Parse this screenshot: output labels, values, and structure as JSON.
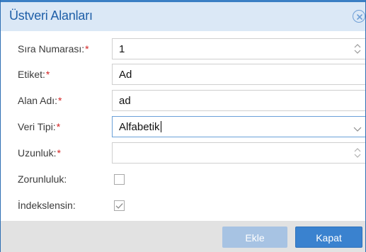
{
  "dialog": {
    "title": "Üstveri Alanları",
    "close_icon": "close-circle-icon"
  },
  "form": {
    "sira_numarasi": {
      "label": "Sıra Numarası:",
      "required_mark": "*",
      "value": "1"
    },
    "etiket": {
      "label": "Etiket:",
      "required_mark": "*",
      "value": "Ad"
    },
    "alan_adi": {
      "label": "Alan Adı:",
      "required_mark": "*",
      "value": "ad"
    },
    "veri_tipi": {
      "label": "Veri Tipi:",
      "required_mark": "*",
      "value": "Alfabetik"
    },
    "uzunluk": {
      "label": "Uzunluk:",
      "required_mark": "*",
      "value": ""
    },
    "zorunluluk": {
      "label": "Zorunluluk:",
      "checked": false
    },
    "indekslensin": {
      "label": "İndekslensin:",
      "checked": true
    }
  },
  "footer": {
    "add_label": "Ekle",
    "close_label": "Kapat"
  },
  "colors": {
    "accent": "#3a82cf",
    "title": "#1f5fa8",
    "required": "#d32222",
    "disabled_button": "#a7c3e3"
  }
}
